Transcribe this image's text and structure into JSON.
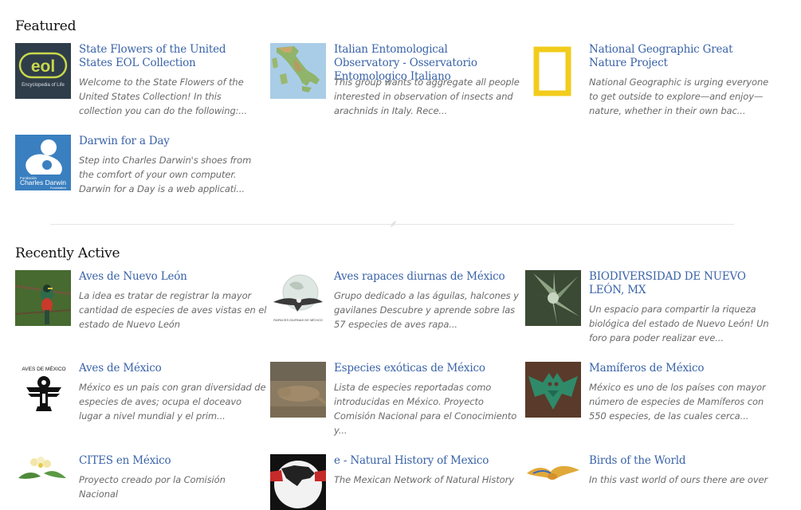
{
  "featured": {
    "heading": "Featured",
    "cards": [
      {
        "title": "State Flowers of the United States EOL Collection",
        "description": "Welcome to the State Flowers of the United States Collection! In this collection you can do the following:...",
        "thumb_icon": "eol-logo-icon",
        "logo_text": "eol",
        "logo_subtext": "Encyclopedia of Life"
      },
      {
        "title": "Italian Entomological Observatory - Osservatorio Entomologico Italiano",
        "description": "This group wants to aggregate all people interested in observation of insects and arachnids in Italy. Rece...",
        "thumb_icon": "italy-map-icon"
      },
      {
        "title": "National Geographic Great Nature Project",
        "description": "National Geographic is urging everyone to get outside to explore—and enjoy—nature, whether in their own bac...",
        "thumb_icon": "natgeo-frame-icon"
      },
      {
        "title": "Darwin for a Day",
        "description": "Step into Charles Darwin's shoes from the comfort of your own computer. Darwin for a Day is a web applicati...",
        "thumb_icon": "darwin-foundation-logo-icon",
        "logo_small": "Fundación",
        "logo_text": "Charles Darwin",
        "logo_subtext": "Foundation"
      }
    ]
  },
  "recent": {
    "heading": "Recently Active",
    "cards": [
      {
        "title": "Aves de Nuevo León",
        "description": "La idea es tratar de registrar la mayor cantidad de especies de aves vistas en el estado de Nuevo León",
        "thumb_icon": "trogon-bird-photo-icon"
      },
      {
        "title": "Aves rapaces diurnas de México",
        "description": "Grupo dedicado a las águilas, halcones y gavilanes Descubre y aprende sobre las 57 especies de aves rapa...",
        "thumb_icon": "eagle-globe-icon",
        "logo_text": "RAPACES DIURNAS DE MÉXICO"
      },
      {
        "title": "BIODIVERSIDAD DE NUEVO LEÓN, MX",
        "description": "Un espacio para compartir la riqueza biológica del estado de Nuevo León! Un foro para poder realizar eve...",
        "thumb_icon": "agave-plant-photo-icon"
      },
      {
        "title": "Aves de México",
        "description": "México es un pais con gran diversidad de especies de aves; ocupa el doceavo lugar a nivel mundial y el prim...",
        "thumb_icon": "aztec-bird-glyph-icon",
        "logo_text": "AVES DE MÉXICO"
      },
      {
        "title": "Especies exóticas de México",
        "description": "Lista de especies reportadas como introducidas en México. Proyecto Comisión Nacional para el Conocimiento y...",
        "thumb_icon": "lizard-photo-icon"
      },
      {
        "title": "Mamíferos de México",
        "description": "México es uno de los países con mayor número de especies de Mamíferos con 550 especies, de las cuales cerca...",
        "thumb_icon": "bat-glyph-icon"
      },
      {
        "title": "CITES en México",
        "description": "Proyecto creado por la Comisión Nacional",
        "thumb_icon": "flower-illustration-icon"
      },
      {
        "title": "e - Natural History of Mexico",
        "description": "The Mexican Network of Natural History",
        "thumb_icon": "north-america-map-icon"
      },
      {
        "title": "Birds of the World",
        "description": "In this vast world of ours there are over",
        "thumb_icon": "flying-parrot-icon"
      }
    ]
  },
  "colors": {
    "link": "#3a63a8",
    "description": "#6a6a6a",
    "heading": "#111111",
    "divider": "#e4e4e4"
  }
}
